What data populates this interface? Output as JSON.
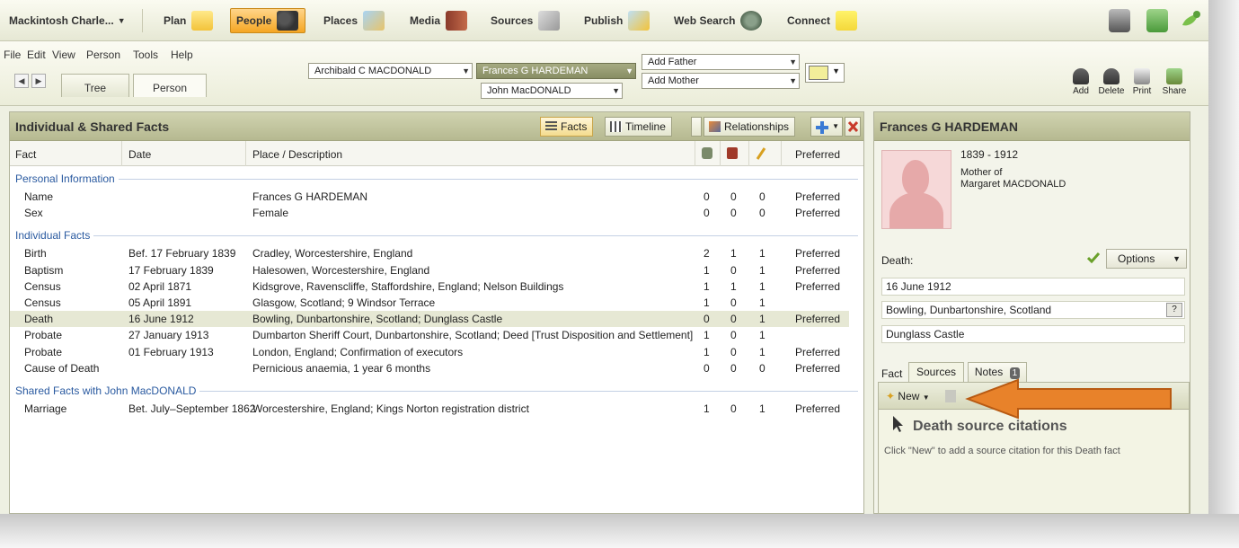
{
  "nav": {
    "person_selector": "Mackintosh Charle...",
    "items": [
      "Plan",
      "People",
      "Places",
      "Media",
      "Sources",
      "Publish",
      "Web Search",
      "Connect"
    ],
    "active": "People"
  },
  "menu": {
    "items": [
      "File",
      "Edit",
      "View",
      "Person",
      "Tools",
      "Help"
    ],
    "view_tabs": [
      "Tree",
      "Person"
    ],
    "active_tab": "Person"
  },
  "family_nav": {
    "spouse": "Archibald C MACDONALD",
    "current": "Frances G HARDEMAN",
    "child": "John MacDONALD",
    "father": "Add Father",
    "mother": "Add Mother"
  },
  "toolbar": {
    "add": "Add",
    "delete": "Delete",
    "print": "Print",
    "share": "Share"
  },
  "facts_panel": {
    "title": "Individual & Shared Facts",
    "buttons": {
      "facts": "Facts",
      "timeline": "Timeline",
      "relationships": "Relationships"
    },
    "columns": [
      "Fact",
      "Date",
      "Place / Description",
      "Preferred"
    ],
    "groups": [
      {
        "label": "Personal Information",
        "rows": [
          {
            "fact": "Name",
            "date": "",
            "place": "Frances G HARDEMAN",
            "sources": "0",
            "media": "0",
            "notes": "0",
            "preferred": "Preferred"
          },
          {
            "fact": "Sex",
            "date": "",
            "place": "Female",
            "sources": "0",
            "media": "0",
            "notes": "0",
            "preferred": "Preferred"
          }
        ]
      },
      {
        "label": "Individual Facts",
        "rows": [
          {
            "fact": "Birth",
            "date": "Bef. 17 February 1839",
            "place": "Cradley, Worcestershire, England",
            "sources": "2",
            "media": "1",
            "notes": "1",
            "preferred": "Preferred"
          },
          {
            "fact": "Baptism",
            "date": "17 February 1839",
            "place": "Halesowen, Worcestershire, England",
            "sources": "1",
            "media": "0",
            "notes": "1",
            "preferred": "Preferred"
          },
          {
            "fact": "Census",
            "date": "02 April 1871",
            "place": "Kidsgrove, Ravenscliffe, Staffordshire, England; Nelson Buildings",
            "sources": "1",
            "media": "1",
            "notes": "1",
            "preferred": "Preferred"
          },
          {
            "fact": "Census",
            "date": "05 April 1891",
            "place": "Glasgow, Scotland; 9 Windsor Terrace",
            "sources": "1",
            "media": "0",
            "notes": "1",
            "preferred": ""
          },
          {
            "fact": "Death",
            "date": "16 June 1912",
            "place": "Bowling, Dunbartonshire, Scotland; Dunglass Castle",
            "sources": "0",
            "media": "0",
            "notes": "1",
            "preferred": "Preferred"
          },
          {
            "fact": "Probate",
            "date": "27 January 1913",
            "place": "Dumbarton Sheriff Court, Dunbartonshire, Scotland; Deed [Trust Disposition and Settlement]",
            "sources": "1",
            "media": "0",
            "notes": "1",
            "preferred": ""
          },
          {
            "fact": "Probate",
            "date": "01 February 1913",
            "place": "London, England; Confirmation of executors",
            "sources": "1",
            "media": "0",
            "notes": "1",
            "preferred": "Preferred"
          },
          {
            "fact": "Cause of Death",
            "date": "",
            "place": "Pernicious anaemia, 1 year 6 months",
            "sources": "0",
            "media": "0",
            "notes": "0",
            "preferred": "Preferred"
          }
        ]
      },
      {
        "label": "Shared Facts with John MacDONALD",
        "rows": [
          {
            "fact": "Marriage",
            "date": "Bet. July–September 1862",
            "place": "Worcestershire, England; Kings Norton registration district",
            "sources": "1",
            "media": "0",
            "notes": "1",
            "preferred": "Preferred"
          }
        ]
      }
    ]
  },
  "person_panel": {
    "name": "Frances G HARDEMAN",
    "years": "1839 - 1912",
    "relation": "Mother of",
    "relation_name": "Margaret MACDONALD",
    "fact_label": "Death:",
    "options": "Options",
    "fact_date": "16 June 1912",
    "fact_place": "Bowling, Dunbartonshire, Scotland",
    "fact_desc": "Dunglass Castle",
    "tab_label": "Fact",
    "tabs": [
      "Sources",
      "Notes"
    ],
    "notes_count": "1",
    "new_button": "New",
    "citations_title": "Death source citations",
    "citations_hint": "Click \"New\" to add a source citation for this Death fact"
  },
  "colors": {
    "accent": "#f5a623",
    "arrow": "#e8822a",
    "group": "#2a5aa0",
    "header": "#b6b991"
  }
}
